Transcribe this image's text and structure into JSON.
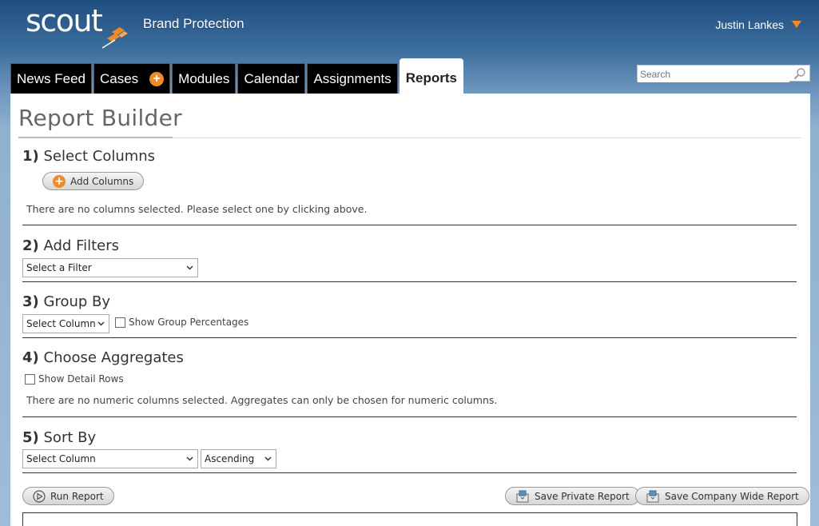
{
  "header": {
    "logo": "scout",
    "brand": "Brand Protection",
    "user_name": "Justin Lankes"
  },
  "tabs": [
    {
      "label": "News Feed"
    },
    {
      "label": "Cases",
      "badge": "+"
    },
    {
      "label": "Modules"
    },
    {
      "label": "Calendar"
    },
    {
      "label": "Assignments"
    },
    {
      "label": "Reports",
      "active": true
    }
  ],
  "search": {
    "placeholder": "Search"
  },
  "page": {
    "title": "Report Builder"
  },
  "sections": {
    "columns": {
      "number": "1)",
      "title": "Select Columns",
      "add_button": "Add Columns",
      "empty_note": "There are no columns selected. Please select one by clicking above."
    },
    "filters": {
      "number": "2)",
      "title": "Add Filters",
      "select_value": "Select a Filter"
    },
    "group": {
      "number": "3)",
      "title": "Group By",
      "select_value": "Select Column",
      "checkbox_label": "Show Group Percentages"
    },
    "aggregates": {
      "number": "4)",
      "title": "Choose Aggregates",
      "checkbox_label": "Show Detail Rows",
      "note": "There are no numeric columns selected. Aggregates can only be chosen for numeric columns."
    },
    "sort": {
      "number": "5)",
      "title": "Sort By",
      "column_value": "Select Column",
      "order_value": "Ascending"
    }
  },
  "actions": {
    "run": "Run Report",
    "save_private": "Save Private Report",
    "save_company": "Save Company Wide Report"
  },
  "colors": {
    "accent": "#f08a24",
    "tab_bg": "#000000",
    "header_bg": "#2b5a8a"
  }
}
